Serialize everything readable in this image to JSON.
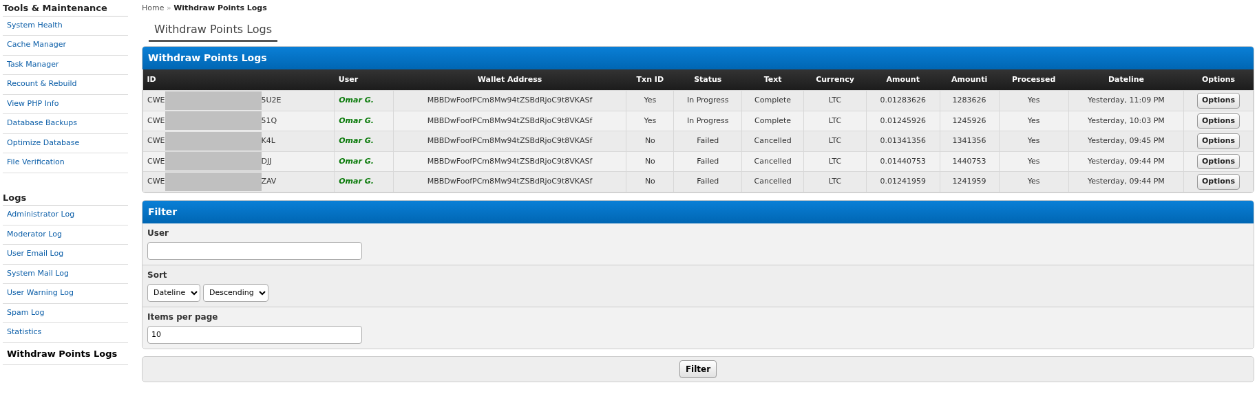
{
  "sidebar": [
    {
      "heading": "Tools & Maintenance",
      "items": [
        {
          "label": "System Health",
          "selected": false
        },
        {
          "label": "Cache Manager",
          "selected": false
        },
        {
          "label": "Task Manager",
          "selected": false
        },
        {
          "label": "Recount & Rebuild",
          "selected": false
        },
        {
          "label": "View PHP Info",
          "selected": false
        },
        {
          "label": "Database Backups",
          "selected": false
        },
        {
          "label": "Optimize Database",
          "selected": false
        },
        {
          "label": "File Verification",
          "selected": false
        }
      ]
    },
    {
      "heading": "Logs",
      "items": [
        {
          "label": "Administrator Log",
          "selected": false
        },
        {
          "label": "Moderator Log",
          "selected": false
        },
        {
          "label": "User Email Log",
          "selected": false
        },
        {
          "label": "System Mail Log",
          "selected": false
        },
        {
          "label": "User Warning Log",
          "selected": false
        },
        {
          "label": "Spam Log",
          "selected": false
        },
        {
          "label": "Statistics",
          "selected": false
        },
        {
          "label": "Withdraw Points Logs",
          "selected": true
        }
      ]
    }
  ],
  "breadcrumb": {
    "home": "Home",
    "separator": "»",
    "current": "Withdraw Points Logs"
  },
  "page_tab": "Withdraw Points Logs",
  "table": {
    "title": "Withdraw Points Logs",
    "columns": [
      "ID",
      "User",
      "Wallet Address",
      "Txn ID",
      "Status",
      "Text",
      "Currency",
      "Amount",
      "Amounti",
      "Processed",
      "Dateline",
      "Options"
    ],
    "rows": [
      {
        "id_start": "CWE",
        "id_end": "5U2E",
        "user": "Omar G.",
        "wallet": "MBBDwFoofPCm8Mw94tZSBdRjoC9t8VKASf",
        "txn": "Yes",
        "status": "In Progress",
        "text": "Complete",
        "currency": "LTC",
        "amount": "0.01283626",
        "amounti": "1283626",
        "processed": "Yes",
        "dateline": "Yesterday, 11:09 PM",
        "option": "Options"
      },
      {
        "id_start": "CWE",
        "id_end": "51Q",
        "user": "Omar G.",
        "wallet": "MBBDwFoofPCm8Mw94tZSBdRjoC9t8VKASf",
        "txn": "Yes",
        "status": "In Progress",
        "text": "Complete",
        "currency": "LTC",
        "amount": "0.01245926",
        "amounti": "1245926",
        "processed": "Yes",
        "dateline": "Yesterday, 10:03 PM",
        "option": "Options"
      },
      {
        "id_start": "CWE",
        "id_end": "K4L",
        "user": "Omar G.",
        "wallet": "MBBDwFoofPCm8Mw94tZSBdRjoC9t8VKASf",
        "txn": "No",
        "status": "Failed",
        "text": "Cancelled",
        "currency": "LTC",
        "amount": "0.01341356",
        "amounti": "1341356",
        "processed": "Yes",
        "dateline": "Yesterday, 09:45 PM",
        "option": "Options"
      },
      {
        "id_start": "CWE",
        "id_end": "DJJ",
        "user": "Omar G.",
        "wallet": "MBBDwFoofPCm8Mw94tZSBdRjoC9t8VKASf",
        "txn": "No",
        "status": "Failed",
        "text": "Cancelled",
        "currency": "LTC",
        "amount": "0.01440753",
        "amounti": "1440753",
        "processed": "Yes",
        "dateline": "Yesterday, 09:44 PM",
        "option": "Options"
      },
      {
        "id_start": "CWE",
        "id_end": "ZAV",
        "user": "Omar G.",
        "wallet": "MBBDwFoofPCm8Mw94tZSBdRjoC9t8VKASf",
        "txn": "No",
        "status": "Failed",
        "text": "Cancelled",
        "currency": "LTC",
        "amount": "0.01241959",
        "amounti": "1241959",
        "processed": "Yes",
        "dateline": "Yesterday, 09:44 PM",
        "option": "Options"
      }
    ]
  },
  "filter": {
    "title": "Filter",
    "user": {
      "label": "User"
    },
    "sort": {
      "label": "Sort",
      "field": "Dateline",
      "order": "Descending"
    },
    "per_page": {
      "label": "Items per page",
      "value": "10"
    },
    "button": "Filter"
  }
}
